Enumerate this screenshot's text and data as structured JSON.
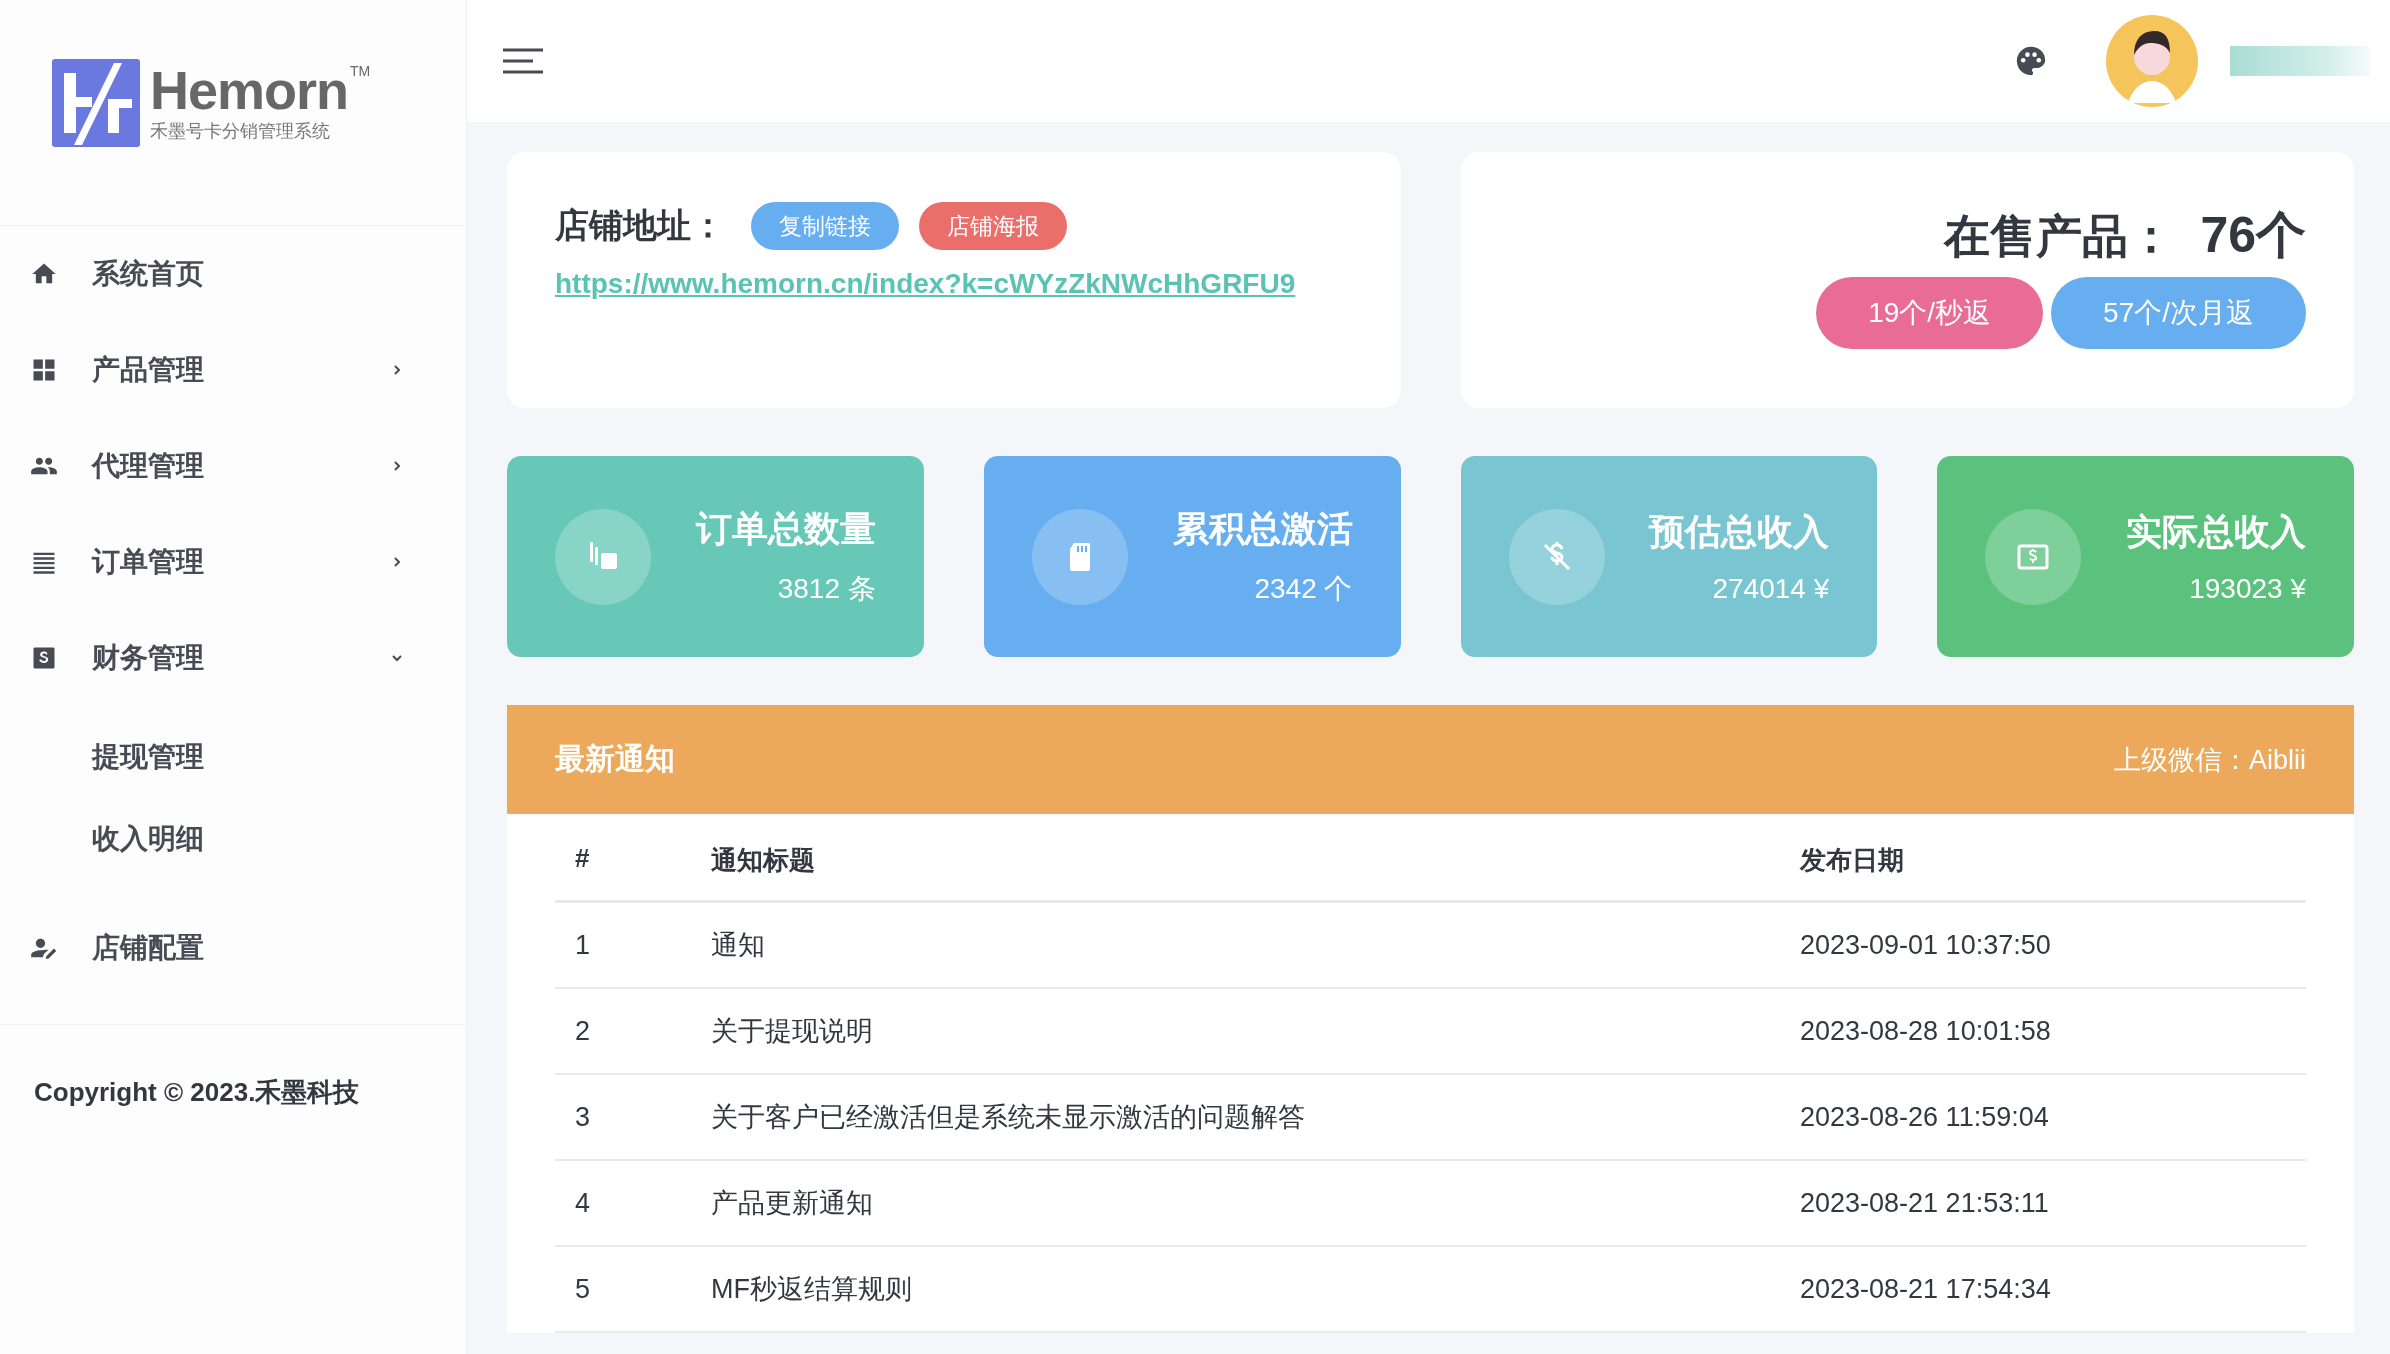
{
  "logo": {
    "name": "Hemorn",
    "tm": "TM",
    "subtitle": "禾墨号卡分销管理系统"
  },
  "sidebar": {
    "items": [
      {
        "label": "系统首页"
      },
      {
        "label": "产品管理",
        "expanded": false
      },
      {
        "label": "代理管理",
        "expanded": false
      },
      {
        "label": "订单管理",
        "expanded": false
      },
      {
        "label": "财务管理",
        "expanded": true,
        "children": [
          {
            "label": "提现管理"
          },
          {
            "label": "收入明细"
          }
        ]
      },
      {
        "label": "店铺配置"
      }
    ],
    "copyright": "Copyright © 2023.禾墨科技"
  },
  "store": {
    "label": "店铺地址：",
    "buttons": [
      {
        "label": "复制链接",
        "color": "#66aef0"
      },
      {
        "label": "店铺海报",
        "color": "#ea6f6a"
      }
    ],
    "url": "https://www.hemorn.cn/index?k=cWYzZkNWcHhGRFU9"
  },
  "products": {
    "label": "在售产品：",
    "count": "76个",
    "badges": [
      {
        "label": "19个/秒返",
        "color": "#e86c96"
      },
      {
        "label": "57个/次月返",
        "color": "#66aef0"
      }
    ]
  },
  "stats": [
    {
      "title": "订单总数量",
      "value": "3812 条",
      "color": "#67c8b8"
    },
    {
      "title": "累积总激活",
      "value": "2342 个",
      "color": "#66aef0"
    },
    {
      "title": "预估总收入",
      "value": "274014 ¥",
      "color": "#79c6d2"
    },
    {
      "title": "实际总收入",
      "value": "193023 ¥",
      "color": "#5bc27e"
    }
  ],
  "notices": {
    "title": "最新通知",
    "contact": "上级微信：Aiblii",
    "columns": [
      "#",
      "通知标题",
      "发布日期"
    ],
    "rows": [
      [
        "1",
        "通知",
        "2023-09-01 10:37:50"
      ],
      [
        "2",
        "关于提现说明",
        "2023-08-28 10:01:58"
      ],
      [
        "3",
        "关于客户已经激活但是系统未显示激活的问题解答",
        "2023-08-26 11:59:04"
      ],
      [
        "4",
        "产品更新通知",
        "2023-08-21 21:53:11"
      ],
      [
        "5",
        "MF秒返结算规则",
        "2023-08-21 17:54:34"
      ]
    ]
  }
}
